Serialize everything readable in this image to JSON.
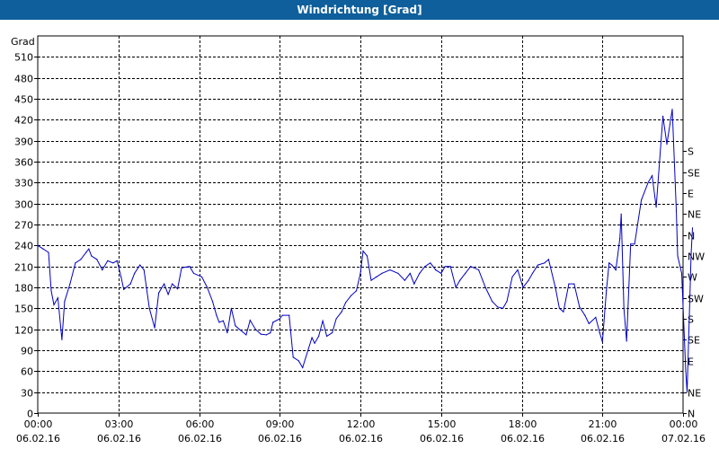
{
  "window": {
    "title": "Windrichtung [Grad]"
  },
  "chart_data": {
    "type": "line",
    "title": "Windrichtung [Grad]",
    "ylabel": "Grad",
    "ylim": [
      0,
      540
    ],
    "yticks": [
      0,
      30,
      60,
      90,
      120,
      150,
      180,
      210,
      240,
      270,
      300,
      330,
      360,
      390,
      420,
      450,
      480,
      510
    ],
    "right_axis_labels": [
      "N",
      "NE",
      "E",
      "SE",
      "S",
      "SW",
      "W",
      "NW",
      "N",
      "NE",
      "E",
      "SE",
      "S"
    ],
    "right_axis_values": [
      0,
      30,
      75,
      105,
      135,
      165,
      195,
      225,
      255,
      285,
      315,
      345,
      375
    ],
    "xlim": [
      0,
      24
    ],
    "xticks": [
      {
        "x": 0,
        "time": "00:00",
        "date": "06.02.16"
      },
      {
        "x": 3,
        "time": "03:00",
        "date": "06.02.16"
      },
      {
        "x": 6,
        "time": "06:00",
        "date": "06.02.16"
      },
      {
        "x": 9,
        "time": "09:00",
        "date": "06.02.16"
      },
      {
        "x": 12,
        "time": "12:00",
        "date": "06.02.16"
      },
      {
        "x": 15,
        "time": "15:00",
        "date": "06.02.16"
      },
      {
        "x": 18,
        "time": "18:00",
        "date": "06.02.16"
      },
      {
        "x": 21,
        "time": "21:00",
        "date": "06.02.16"
      },
      {
        "x": 24,
        "time": "00:00",
        "date": "07.02.16"
      }
    ],
    "grid": true,
    "series": [
      {
        "color": "#0000c0",
        "points": [
          [
            0.0,
            240
          ],
          [
            0.2,
            235
          ],
          [
            0.4,
            230
          ],
          [
            0.5,
            175
          ],
          [
            0.6,
            155
          ],
          [
            0.75,
            165
          ],
          [
            0.9,
            105
          ],
          [
            1.0,
            160
          ],
          [
            1.2,
            185
          ],
          [
            1.4,
            215
          ],
          [
            1.6,
            220
          ],
          [
            1.8,
            230
          ],
          [
            1.9,
            235
          ],
          [
            2.0,
            225
          ],
          [
            2.2,
            220
          ],
          [
            2.4,
            205
          ],
          [
            2.6,
            218
          ],
          [
            2.8,
            215
          ],
          [
            2.95,
            218
          ],
          [
            3.1,
            195
          ],
          [
            3.2,
            177
          ],
          [
            3.45,
            185
          ],
          [
            3.6,
            200
          ],
          [
            3.8,
            212
          ],
          [
            3.95,
            205
          ],
          [
            4.15,
            150
          ],
          [
            4.35,
            122
          ],
          [
            4.5,
            172
          ],
          [
            4.7,
            185
          ],
          [
            4.85,
            170
          ],
          [
            5.0,
            185
          ],
          [
            5.2,
            178
          ],
          [
            5.35,
            208
          ],
          [
            5.65,
            210
          ],
          [
            5.8,
            200
          ],
          [
            6.1,
            195
          ],
          [
            6.3,
            180
          ],
          [
            6.5,
            160
          ],
          [
            6.65,
            140
          ],
          [
            6.75,
            130
          ],
          [
            6.9,
            132
          ],
          [
            7.05,
            115
          ],
          [
            7.2,
            150
          ],
          [
            7.35,
            125
          ],
          [
            7.5,
            120
          ],
          [
            7.75,
            112
          ],
          [
            7.9,
            133
          ],
          [
            8.1,
            120
          ],
          [
            8.3,
            113
          ],
          [
            8.5,
            112
          ],
          [
            8.65,
            115
          ],
          [
            8.75,
            130
          ],
          [
            9.0,
            135
          ],
          [
            9.1,
            140
          ],
          [
            9.35,
            140
          ],
          [
            9.5,
            80
          ],
          [
            9.7,
            75
          ],
          [
            9.85,
            65
          ],
          [
            10.05,
            90
          ],
          [
            10.2,
            108
          ],
          [
            10.3,
            100
          ],
          [
            10.45,
            110
          ],
          [
            10.6,
            132
          ],
          [
            10.75,
            110
          ],
          [
            10.95,
            115
          ],
          [
            11.1,
            135
          ],
          [
            11.3,
            145
          ],
          [
            11.45,
            158
          ],
          [
            11.65,
            168
          ],
          [
            11.85,
            175
          ],
          [
            12.0,
            200
          ],
          [
            12.1,
            232
          ],
          [
            12.25,
            225
          ],
          [
            12.4,
            190
          ],
          [
            12.6,
            195
          ],
          [
            12.8,
            200
          ],
          [
            13.1,
            205
          ],
          [
            13.4,
            200
          ],
          [
            13.65,
            190
          ],
          [
            13.85,
            200
          ],
          [
            14.0,
            185
          ],
          [
            14.2,
            200
          ],
          [
            14.4,
            210
          ],
          [
            14.6,
            215
          ],
          [
            14.8,
            205
          ],
          [
            15.0,
            200
          ],
          [
            15.15,
            210
          ],
          [
            15.35,
            210
          ],
          [
            15.55,
            180
          ],
          [
            15.7,
            190
          ],
          [
            15.9,
            200
          ],
          [
            16.1,
            210
          ],
          [
            16.4,
            205
          ],
          [
            16.65,
            180
          ],
          [
            16.9,
            160
          ],
          [
            17.1,
            152
          ],
          [
            17.3,
            150
          ],
          [
            17.45,
            160
          ],
          [
            17.65,
            195
          ],
          [
            17.85,
            205
          ],
          [
            18.05,
            180
          ],
          [
            18.25,
            190
          ],
          [
            18.4,
            200
          ],
          [
            18.6,
            212
          ],
          [
            18.85,
            215
          ],
          [
            19.0,
            220
          ],
          [
            19.25,
            180
          ],
          [
            19.4,
            150
          ],
          [
            19.55,
            145
          ],
          [
            19.75,
            185
          ],
          [
            19.95,
            185
          ],
          [
            20.15,
            152
          ],
          [
            20.35,
            140
          ],
          [
            20.5,
            128
          ],
          [
            20.75,
            137
          ],
          [
            20.9,
            115
          ],
          [
            21.0,
            102
          ],
          [
            21.15,
            175
          ],
          [
            21.25,
            215
          ],
          [
            21.35,
            212
          ],
          [
            21.5,
            205
          ],
          [
            21.65,
            250
          ],
          [
            21.7,
            285
          ],
          [
            21.8,
            150
          ],
          [
            21.9,
            103
          ],
          [
            22.05,
            242
          ],
          [
            22.2,
            242
          ],
          [
            22.45,
            305
          ],
          [
            22.7,
            330
          ],
          [
            22.85,
            340
          ],
          [
            23.0,
            295
          ],
          [
            23.25,
            425
          ],
          [
            23.4,
            385
          ],
          [
            23.6,
            435
          ],
          [
            23.75,
            290
          ],
          [
            23.8,
            225
          ],
          [
            23.95,
            200
          ],
          [
            24.1,
            60
          ],
          [
            24.15,
            30
          ],
          [
            24.3,
            228
          ],
          [
            24.35,
            265
          ]
        ]
      }
    ]
  }
}
